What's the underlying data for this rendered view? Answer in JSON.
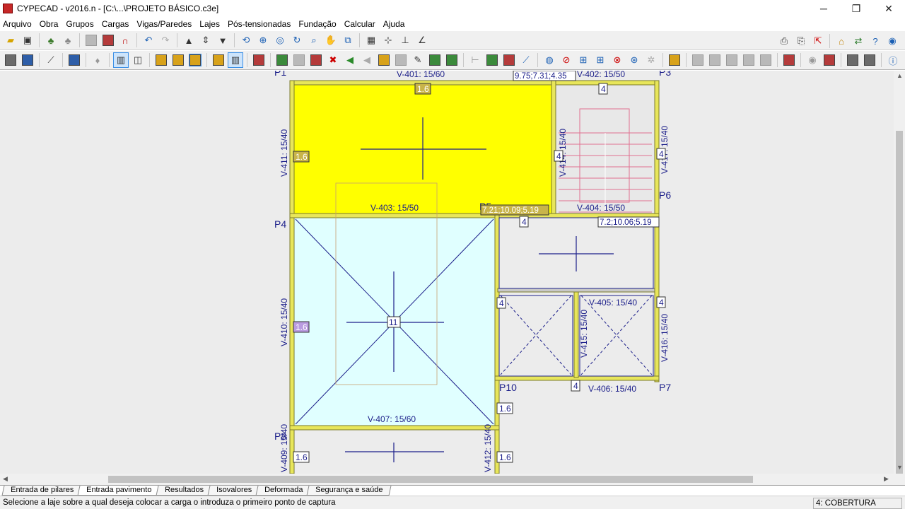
{
  "window": {
    "title": "CYPECAD - v2016.n - [C:\\...\\PROJETO BÁSICO.c3e]",
    "minimize": "─",
    "maximize": "❐",
    "close": "✕"
  },
  "menu": [
    "Arquivo",
    "Obra",
    "Grupos",
    "Cargas",
    "Vigas/Paredes",
    "Lajes",
    "Pós-tensionadas",
    "Fundação",
    "Calcular",
    "Ajuda"
  ],
  "drawing": {
    "pillars": [
      "P1",
      "P3",
      "P4",
      "P5",
      "P6",
      "P7",
      "P10",
      "P8"
    ],
    "beams": {
      "v401": "V-401: 15/60",
      "v402": "V-402: 15/50",
      "v403": "V-403: 15/50",
      "v404": "V-404: 15/50",
      "v405": "V-405: 15/40",
      "v406": "V-406: 15/40",
      "v407": "V-407: 15/60",
      "v409": "V-409: 15/40",
      "v410": "V-410: 15/40",
      "v411": "V-411: 15/40",
      "v412": "V-412: 15/40",
      "v414": "V-414: 15/40",
      "v415": "V-415: 15/40",
      "v416": "V-416: 15/40",
      "v417": "V-417: 15/40"
    },
    "coordinates": {
      "c1": "9.75;7.31;4.35",
      "c2": "7.21;10.09;5.19",
      "c3": "7.2;10.06;5.19"
    },
    "load_tags": {
      "a": "1.6",
      "b": "4",
      "c": "11"
    }
  },
  "tabs": [
    "Entrada de pilares",
    "Entrada pavimento",
    "Resultados",
    "Isovalores",
    "Deformada",
    "Segurança e saúde"
  ],
  "active_tab": "Entrada pavimento",
  "status": {
    "message": "Selecione a laje sobre a qual deseja colocar a carga o introduza o primeiro ponto de captura",
    "floor": "4: COBERTURA"
  },
  "colors": {
    "slab_selected": "#ffff00",
    "slab_normal": "#e0ffff",
    "beam": "#e8e65a",
    "text_blue": "#1c1f8a",
    "stair": "#e0a0b0"
  }
}
